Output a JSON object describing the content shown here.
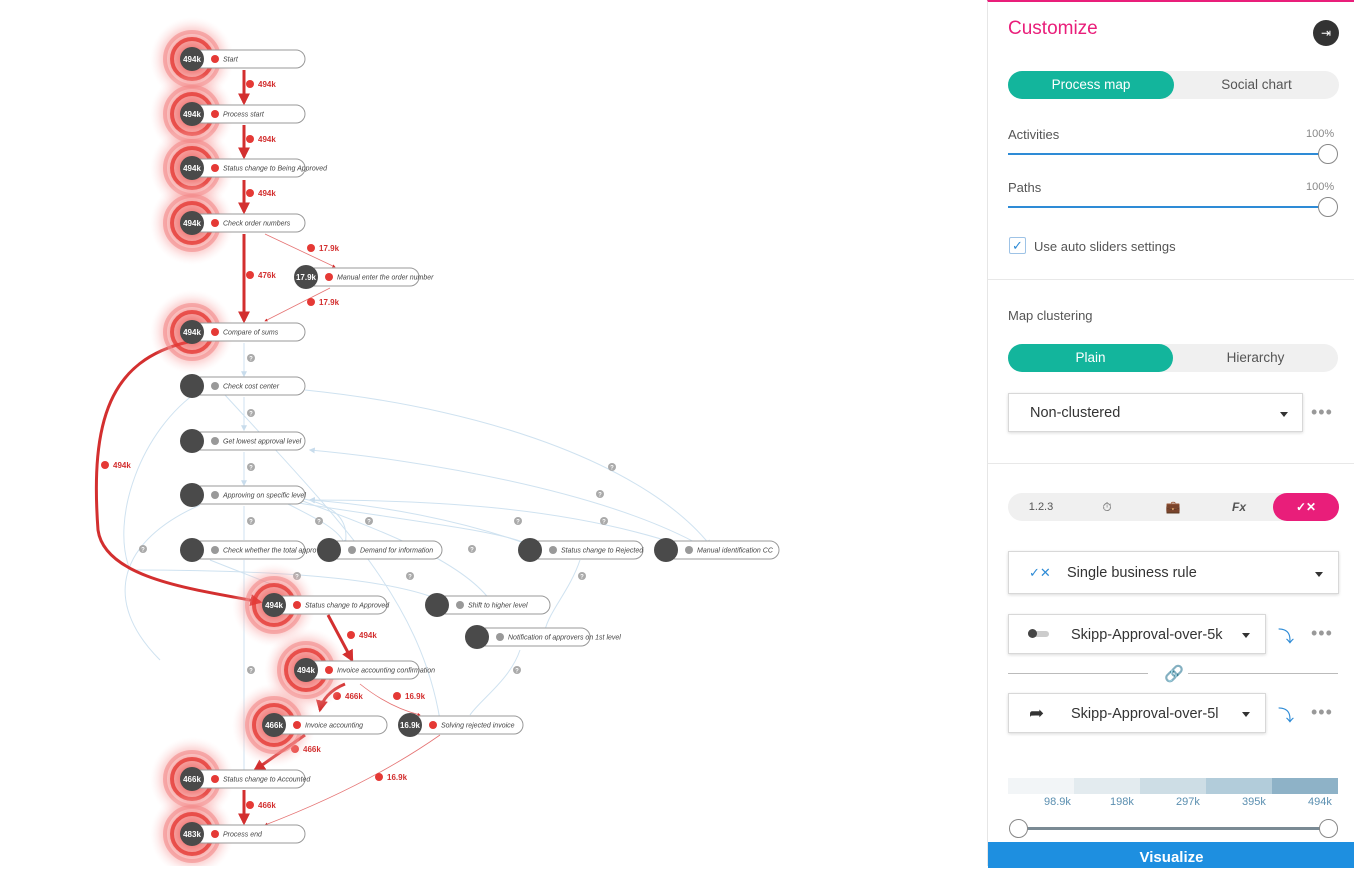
{
  "process_map": {
    "nodes": [
      {
        "id": "start",
        "badge": "494k",
        "label": "Start",
        "hot": true
      },
      {
        "id": "process_start",
        "badge": "494k",
        "label": "Process start",
        "hot": true
      },
      {
        "id": "status_being_approved",
        "badge": "494k",
        "label": "Status change to Being Approved",
        "hot": true
      },
      {
        "id": "check_order_numbers",
        "badge": "494k",
        "label": "Check order numbers",
        "hot": true
      },
      {
        "id": "manual_enter_order",
        "badge": "17.9k",
        "label": "Manual enter the order number",
        "hot": false
      },
      {
        "id": "compare_sums",
        "badge": "494k",
        "label": "Compare of sums",
        "hot": true
      },
      {
        "id": "check_cost_center",
        "badge": "",
        "label": "Check cost center",
        "hot": false
      },
      {
        "id": "get_lowest_approval",
        "badge": "",
        "label": "Get lowest approval level",
        "hot": false
      },
      {
        "id": "approving_specific",
        "badge": "",
        "label": "Approving on specific level",
        "hot": false
      },
      {
        "id": "check_whether_total",
        "badge": "",
        "label": "Check whether the total approval",
        "hot": false
      },
      {
        "id": "demand_info",
        "badge": "",
        "label": "Demand for information",
        "hot": false
      },
      {
        "id": "status_rejected",
        "badge": "",
        "label": "Status change to Rejected",
        "hot": false
      },
      {
        "id": "manual_identification",
        "badge": "",
        "label": "Manual identification CC",
        "hot": false
      },
      {
        "id": "status_approved",
        "badge": "494k",
        "label": "Status change to Approved",
        "hot": true
      },
      {
        "id": "shift_higher",
        "badge": "",
        "label": "Shift to higher level",
        "hot": false
      },
      {
        "id": "notification",
        "badge": "",
        "label": "Notification of approvers on 1st level",
        "hot": false
      },
      {
        "id": "invoice_confirmation",
        "badge": "494k",
        "label": "Invoice accounting confirmation",
        "hot": true
      },
      {
        "id": "invoice_accounting",
        "badge": "466k",
        "label": "Invoice accounting",
        "hot": true
      },
      {
        "id": "solving_rejected",
        "badge": "16.9k",
        "label": "Solving rejected invoice",
        "hot": false
      },
      {
        "id": "status_accounted",
        "badge": "466k",
        "label": "Status change to Accounted",
        "hot": true
      },
      {
        "id": "process_end",
        "badge": "483k",
        "label": "Process end",
        "hot": true
      }
    ],
    "edge_labels": [
      "494k",
      "494k",
      "494k",
      "476k",
      "17.9k",
      "17.9k",
      "494k",
      "494k",
      "466k",
      "16.9k",
      "466k",
      "466k",
      "16.9k"
    ],
    "unknown_marker": "?"
  },
  "panel": {
    "title": "Customize",
    "pin_icon": "pin-icon",
    "view_toggle": {
      "options": [
        "Process map",
        "Social chart"
      ],
      "active": 0
    },
    "activities": {
      "label": "Activities",
      "value": "100%"
    },
    "paths": {
      "label": "Paths",
      "value": "100%"
    },
    "auto_sliders": {
      "label": "Use auto sliders settings",
      "checked": true
    },
    "map_clustering": {
      "label": "Map clustering",
      "options": [
        "Plain",
        "Hierarchy"
      ],
      "active": 0,
      "select_value": "Non-clustered"
    },
    "metric_tabs": {
      "items": [
        "1.2.3",
        "timer-icon",
        "briefcase-icon",
        "function-icon",
        "business-rule-icon"
      ],
      "active": 4,
      "first_label": "1.2.3",
      "fx_label": "Fx"
    },
    "rule_type": {
      "icon": "check-cross-icon",
      "value": "Single business rule"
    },
    "rule_one": {
      "icon": "toggle-icon",
      "value": "Skipp-Approval-over-5k"
    },
    "rule_two": {
      "icon": "redirect-arrow-icon",
      "value": "Skipp-Approval-over-5l"
    },
    "scale": {
      "labels": [
        "98.9k",
        "198k",
        "297k",
        "395k",
        "494k"
      ],
      "colors": [
        "#f2f5f7",
        "#e3ebef",
        "#cddde5",
        "#b2ccda",
        "#8eb2c7"
      ]
    },
    "visualize_label": "Visualize",
    "accent": "#13b59c",
    "brand": "#e91e7a"
  }
}
